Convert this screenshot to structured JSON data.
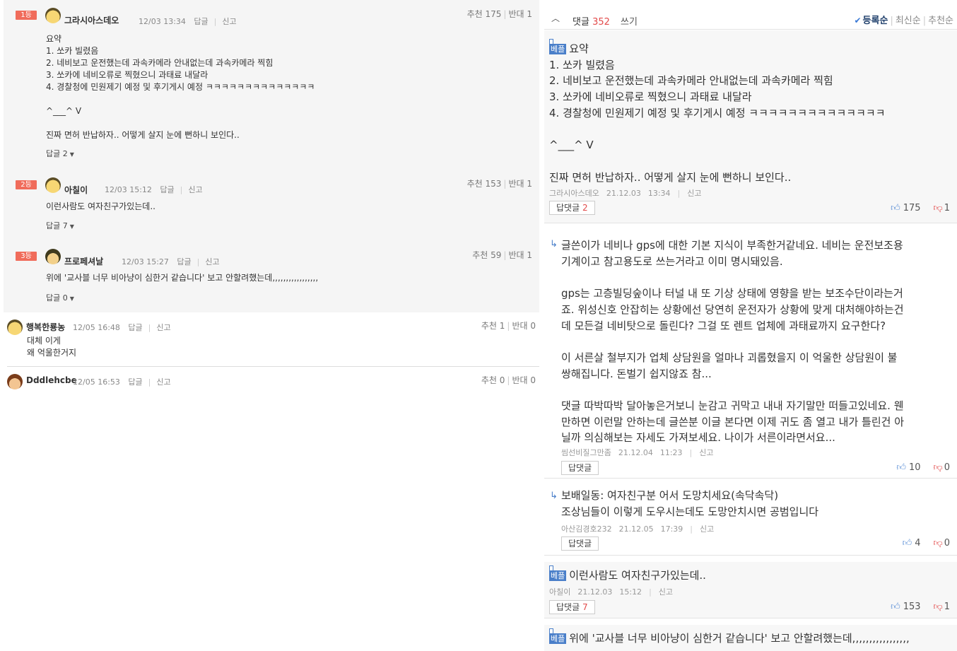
{
  "left": {
    "best": [
      {
        "rank": "1등",
        "nick": "그라시아스데오",
        "date": "12/03 13:34",
        "reply": "답글",
        "report": "신고",
        "up": "추천 175",
        "down": "반대 1",
        "body": "요약\n1. 쏘카 빌렸음\n2. 네비보고 운전했는데 과속카메라 안내없는데 과속카메라 찍힘\n3. 쏘카에 네비오류로 찍혔으니 과태료 내달라\n4. 경찰청에 민원제기 예정 및 후기게시 예정 ㅋㅋㅋㅋㅋㅋㅋㅋㅋㅋㅋㅋㅋㅋ\n\n^___^ V\n\n진짜 면허 반납하자.. 어떻게 살지 눈에 뻔하니 보인다..",
        "replies": "답글 2"
      },
      {
        "rank": "2등",
        "nick": "아칠이",
        "date": "12/03 15:12",
        "reply": "답글",
        "report": "신고",
        "up": "추천 153",
        "down": "반대 1",
        "body": "이런사람도 여자친구가있는데..",
        "replies": "답글 7"
      },
      {
        "rank": "3등",
        "nick": "프로페셔날",
        "date": "12/03 15:27",
        "reply": "답글",
        "report": "신고",
        "up": "추천 59",
        "down": "반대 1",
        "body": "위에 '교사블 너무 비아냥이 심한거 같습니다' 보고 안할려했는데,,,,,,,,,,,,,,,,,",
        "replies": "답글 0"
      }
    ],
    "normal": [
      {
        "nick": "행복한룡농",
        "date": "12/05 16:48",
        "reply": "답글",
        "report": "신고",
        "up": "추천 1",
        "down": "반대 0",
        "body": "대체 이게\n왜 억울한거지"
      },
      {
        "nick": "Dddlehcbe",
        "date": "12/05 16:53",
        "reply": "답글",
        "report": "신고",
        "up": "추천 0",
        "down": "반대 0",
        "body": ""
      }
    ]
  },
  "right": {
    "header": {
      "count_label": "댓글",
      "count": "352",
      "write": "쓰기",
      "sort_active": "등록순",
      "sort_recent": "최신순",
      "sort_recommend": "추천순"
    },
    "badge": "베플",
    "cards": [
      {
        "body_first": "요약",
        "body": "1. 쏘카 빌렸음\n2. 네비보고 운전했는데 과속카메라 안내없는데 과속카메라 찍힘\n3. 쏘카에 네비오류로 찍혔으니 과태료 내달라\n4. 경찰청에 민원제기 예정 및 후기게시 예정 ㅋㅋㅋㅋㅋㅋㅋㅋㅋㅋㅋㅋㅋㅋ\n\n^___^ V\n\n진짜 면허 반납하자.. 어떻게 살지 눈에 뻔하니 보인다..",
        "nick": "그라시아스데오",
        "date": "21.12.03",
        "time": "13:34",
        "report": "신고",
        "reply_label": "답댓글",
        "reply_count": "2",
        "up": "175",
        "down": "1"
      },
      {
        "body_first": "이런사람도 여자친구가있는데..",
        "nick": "아칠이",
        "date": "21.12.03",
        "time": "15:12",
        "report": "신고",
        "reply_label": "답댓글",
        "reply_count": "7",
        "up": "153",
        "down": "1"
      },
      {
        "body_first": "위에 '교사블 너무 비아냥이 심한거 같습니다' 보고 안할려했는데,,,,,,,,,,,,,,,,,"
      }
    ],
    "subs": [
      {
        "body": "글쓴이가 네비나 gps에 대한 기본 지식이 부족한거같네요. 네비는 운전보조용\n기계이고 참고용도로 쓰는거라고 이미 명시돼있음.\n\ngps는 고층빌딩숲이나 터널 내 또 기상 상태에 영향을 받는 보조수단이라는거\n죠. 위성신호 안잡히는 상황에선 당연히 운전자가 상황에 맞게 대처해야하는건\n데 모든걸 네비탓으로 돌린다? 그걸 또 렌트 업체에 과태료까지 요구한다?\n\n이 서른살 철부지가 업체 상담원을 얼마나 괴롭혔을지 이 억울한 상담원이 불\n쌍해집니다. 돈벌기 쉽지않죠 참...\n\n댓글 따박따박 달아놓은거보니 눈감고 귀막고 내내 자기말만 떠들고있네요. 웬\n만하면 이런말 안하는데 글쓴분 이글 본다면 이제 귀도 좀 열고 내가 틀린건 아\n닐까 의심해보는 자세도 가져보세요. 나이가 서른이라면서요...",
        "nick": "씸선비질그만좀",
        "date": "21.12.04",
        "time": "11:23",
        "report": "신고",
        "reply_label": "답댓글",
        "up": "10",
        "down": "0"
      },
      {
        "body": "보배일동: 여자친구분 어서 도망치세요(속닥속닥)\n조상님들이 이렇게 도우시는데도 도망안치시면 공범입니다",
        "nick": "아산김경호232",
        "date": "21.12.05",
        "time": "17:39",
        "report": "신고",
        "reply_label": "답댓글",
        "up": "4",
        "down": "0"
      }
    ]
  }
}
